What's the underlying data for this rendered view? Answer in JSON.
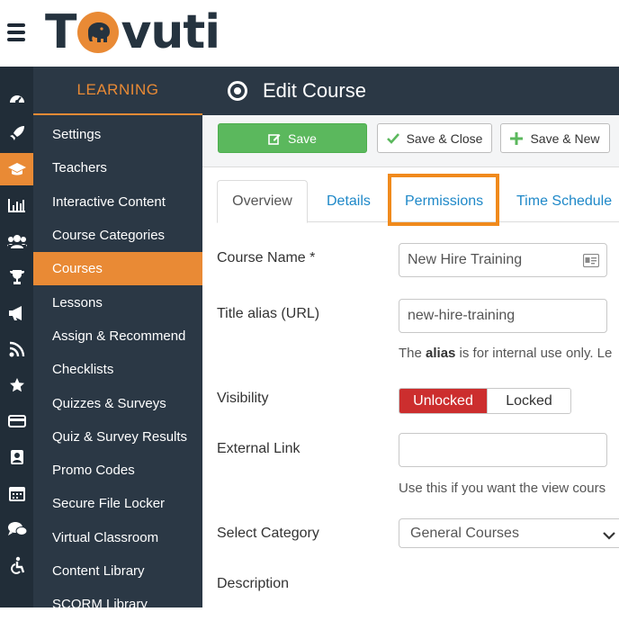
{
  "brand": {
    "name": "Tavuti",
    "logo_left": "T",
    "logo_right": "vuti",
    "accent": "#e98a35",
    "dark": "#2b3845"
  },
  "sidebar": {
    "heading": "LEARNING",
    "items": [
      {
        "label": "Settings",
        "active": false
      },
      {
        "label": "Teachers",
        "active": false
      },
      {
        "label": "Interactive Content",
        "active": false
      },
      {
        "label": "Course Categories",
        "active": false
      },
      {
        "label": "Courses",
        "active": true
      },
      {
        "label": "Lessons",
        "active": false
      },
      {
        "label": "Assign & Recommend",
        "active": false
      },
      {
        "label": "Checklists",
        "active": false
      },
      {
        "label": "Quizzes & Surveys",
        "active": false
      },
      {
        "label": "Quiz & Survey Results",
        "active": false
      },
      {
        "label": "Promo Codes",
        "active": false
      },
      {
        "label": "Secure File Locker",
        "active": false
      },
      {
        "label": "Virtual Classroom",
        "active": false
      },
      {
        "label": "Content Library",
        "active": false
      },
      {
        "label": "SCORM Library",
        "active": false
      }
    ]
  },
  "iconbar": [
    "dashboard-icon",
    "rocket-icon",
    "graduation-cap-icon",
    "chart-icon",
    "users-icon",
    "trophy-icon",
    "bullhorn-icon",
    "feed-icon",
    "star-icon",
    "credit-card-icon",
    "badge-icon",
    "calendar-icon",
    "comments-icon",
    "accessibility-icon"
  ],
  "header": {
    "title": "Edit Course"
  },
  "toolbar": {
    "save_label": "Save",
    "save_close_label": "Save & Close",
    "save_new_label": "Save & New"
  },
  "tabs": {
    "overview": "Overview",
    "details": "Details",
    "permissions": "Permissions",
    "time_schedule": "Time Schedule"
  },
  "form": {
    "course_name_label": "Course Name *",
    "course_name_value": "New Hire Training",
    "alias_label": "Title alias (URL)",
    "alias_value": "new-hire-training",
    "alias_help_prefix": "The ",
    "alias_help_bold": "alias",
    "alias_help_suffix": " is for internal use only. Le",
    "visibility_label": "Visibility",
    "visibility_on": "Unlocked",
    "visibility_off": "Locked",
    "external_link_label": "External Link",
    "external_link_value": "",
    "external_link_help": "Use this if you want the view cours",
    "category_label": "Select Category",
    "category_value": "General Courses",
    "description_label": "Description"
  }
}
